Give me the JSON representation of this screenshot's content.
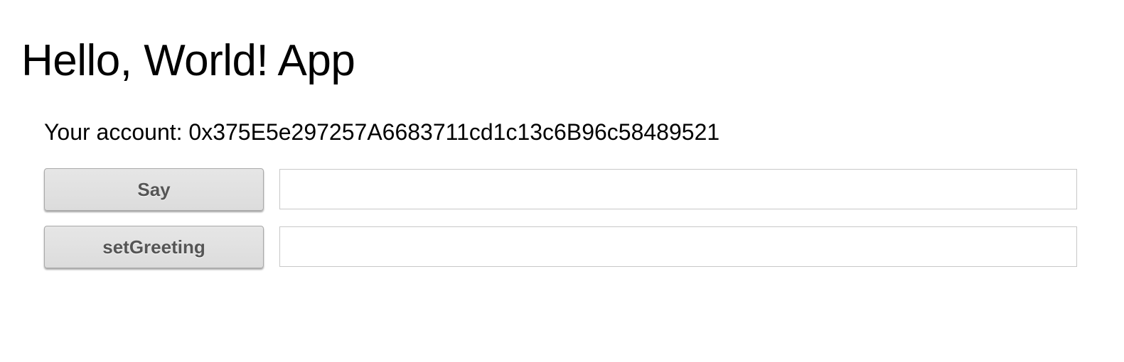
{
  "app": {
    "title": "Hello, World! App"
  },
  "account": {
    "label": "Your account: ",
    "address": "0x375E5e297257A6683711cd1c13c6B96c58489521"
  },
  "say": {
    "button_label": "Say",
    "field_value": ""
  },
  "set_greeting": {
    "button_label": "setGreeting",
    "field_value": ""
  }
}
